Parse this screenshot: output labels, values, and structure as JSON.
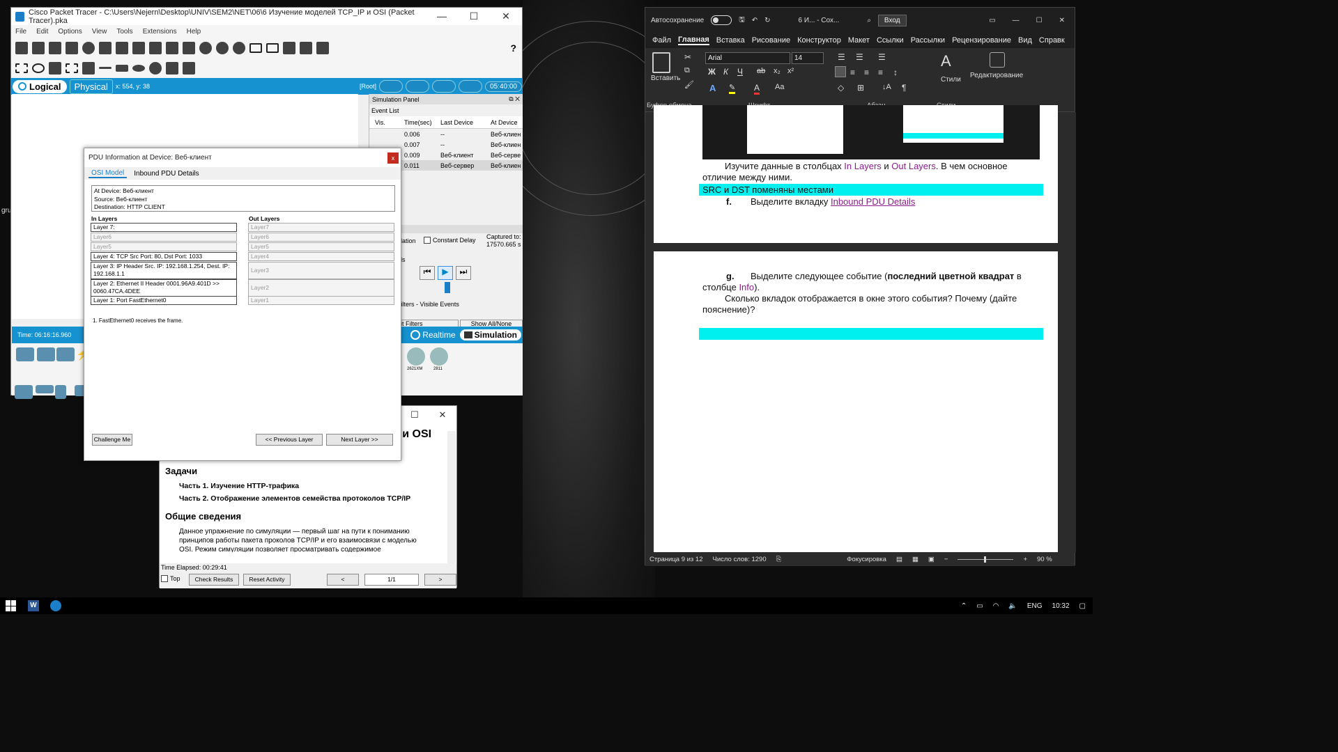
{
  "desktop": {
    "side_label": "gru"
  },
  "packet_tracer": {
    "title": "Cisco Packet Tracer - C:\\Users\\Nejern\\Desktop\\UNIV\\SEM2\\NET\\06\\6 Изучение моделей TCP_IP и OSI (Packet Tracer).pka",
    "menu": [
      "File",
      "Edit",
      "Options",
      "View",
      "Tools",
      "Extensions",
      "Help"
    ],
    "logical_tab": "Logical",
    "physical_tab": "Physical",
    "coords": "x: 554, y: 38",
    "root": "[Root]",
    "clock": "05:40:00",
    "time_label": "Time: 06:16:16.960",
    "realtime": "Realtime",
    "simulation": "Simulation",
    "sim_panel_title": "Simulation Panel",
    "event_list_label": "Event List",
    "event_headers": [
      "Vis.",
      "Time(sec)",
      "Last Device",
      "At Device"
    ],
    "events": [
      {
        "time": "0.006",
        "last": "--",
        "at": "Веб-клиен"
      },
      {
        "time": "0.007",
        "last": "--",
        "at": "Веб-клиен"
      },
      {
        "time": "0.009",
        "last": "Веб-клиент",
        "at": "Веб-серве"
      },
      {
        "time": "0.011",
        "last": "Веб-сервер",
        "at": "Веб-клиен"
      }
    ],
    "sim_fragment": "ulation",
    "constant_delay": "Constant Delay",
    "captured_to_label": "Captured to:",
    "captured_to_value": "17570.665 s",
    "controls_fragment": "ols",
    "filters_visible": "Filters - Visible Events",
    "edit_filters": "it Filters",
    "show_all": "Show All/None",
    "device_labels": [
      "2621XM",
      "2811"
    ]
  },
  "pdu": {
    "title": "PDU Information at Device: Веб-клиент",
    "tabs": [
      "OSI Model",
      "Inbound PDU Details"
    ],
    "at_device": "At Device: Веб-клиент",
    "source": "Source: Веб-клиент",
    "destination": "Destination: HTTP CLIENT",
    "in_header": "In Layers",
    "out_header": "Out Layers",
    "in_layers": [
      "Layer 7:",
      "Layer6",
      "Layer5",
      "Layer 4: TCP Src Port: 80, Dst Port: 1033",
      "Layer 3: IP Header Src. IP: 192.168.1.254, Dest. IP: 192.168.1.1",
      "Layer 2: Ethernet II Header 0001.96A9.401D >> 0060.47CA.4DEE",
      "Layer 1: Port FastEthernet0"
    ],
    "out_layers": [
      "Layer7",
      "Layer6",
      "Layer5",
      "Layer4",
      "Layer3",
      "Layer2",
      "Layer1"
    ],
    "message": "1. FastEthernet0 receives the frame.",
    "challenge": "Challenge Me",
    "prev": "<< Previous Layer",
    "next": "Next Layer >>",
    "close": "x"
  },
  "instructions": {
    "heading_fragment": "' и OSI",
    "tasks_title": "Задачи",
    "part1": "Часть 1. Изучение HTTP-трафика",
    "part2": "Часть 2. Отображение элементов семейства протоколов TCP/IP",
    "general_title": "Общие сведения",
    "paragraph": "Данное упражнение по симуляции — первый шаг на пути к пониманию принципов работы пакета проколов TCP/IP и его взаимосвязи с моделью OSI. Режим симуляции позволяет просматривать содержимое пересылаемых по сети данных на каждом из уровней.",
    "elapsed": "Time Elapsed: 00:29:41",
    "top": "Top",
    "check": "Check Results",
    "reset": "Reset Activity",
    "prev": "<",
    "page": "1/1",
    "next": ">"
  },
  "word": {
    "autosave": "Автосохранение",
    "doc_title": "6 И... - Сох...",
    "signin": "Вход",
    "tabs": [
      "Файл",
      "Главная",
      "Вставка",
      "Рисование",
      "Конструктор",
      "Макет",
      "Ссылки",
      "Рассылки",
      "Рецензирование",
      "Вид",
      "Справк"
    ],
    "active_tab": "Главная",
    "paste": "Вставить",
    "font_name": "Arial",
    "font_size": "14",
    "styles": "Стили",
    "editing": "Редактирование",
    "groups": [
      "Буфер обмена",
      "Шрифт",
      "Абзац",
      "Стили"
    ],
    "p1a": "Изучите данные в столбцах ",
    "p1_in": "In Layers",
    "p1_and": " и ",
    "p1_out": "Out Layers",
    "p1b": ". В чем основное",
    "p1c": "отличие между ними.",
    "answer": "SRC и DST поменяны местами",
    "f_label": "f.",
    "f_text": "Выделите вкладку ",
    "f_link": "Inbound PDU Details",
    "g_label": "g.",
    "g_text1": "Выделите следующее событие (",
    "g_bold": "последний цветной квадрат",
    "g_text2": " в",
    "g_text3": "столбце ",
    "g_info": "Info",
    "g_text4": ").",
    "q_line1": "Сколько вкладок отображается в окне этого события? Почему (дайте",
    "q_line2": "пояснение)?",
    "status_page": "Страница 9 из 12",
    "status_words": "Число слов: 1290",
    "focus": "Фокусировка",
    "zoom": "90 %"
  },
  "taskbar": {
    "lang": "ENG",
    "time": "10:32"
  }
}
